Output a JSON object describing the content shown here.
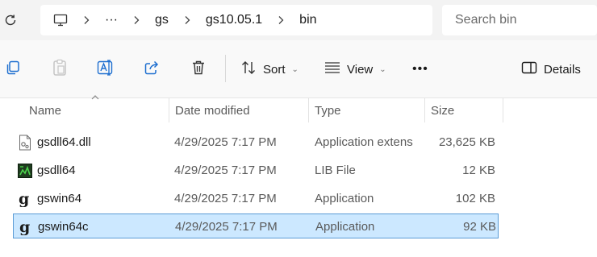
{
  "breadcrumb": [
    "gs",
    "gs10.05.1",
    "bin"
  ],
  "more_crumbs": "···",
  "search": {
    "placeholder": "Search bin"
  },
  "toolbar": {
    "sort_label": "Sort",
    "view_label": "View",
    "more_label": "•••",
    "details_label": "Details"
  },
  "columns": {
    "name": "Name",
    "date": "Date modified",
    "type": "Type",
    "size": "Size"
  },
  "files": [
    {
      "name": "gsdll64.dll",
      "date": "4/29/2025 7:17 PM",
      "type": "Application extens",
      "size": "23,625 KB",
      "icon": "dll-file-icon"
    },
    {
      "name": "gsdll64",
      "date": "4/29/2025 7:17 PM",
      "type": "LIB File",
      "size": "12 KB",
      "icon": "lib-file-icon"
    },
    {
      "name": "gswin64",
      "date": "4/29/2025 7:17 PM",
      "type": "Application",
      "size": "102 KB",
      "icon": "ghostscript-app-icon"
    },
    {
      "name": "gswin64c",
      "date": "4/29/2025 7:17 PM",
      "type": "Application",
      "size": "92 KB",
      "icon": "ghostscript-app-icon",
      "selected": true
    }
  ],
  "colors": {
    "selection_bg": "#cce8ff",
    "selection_border": "#5a9bd5",
    "accent": "#005fb8"
  }
}
